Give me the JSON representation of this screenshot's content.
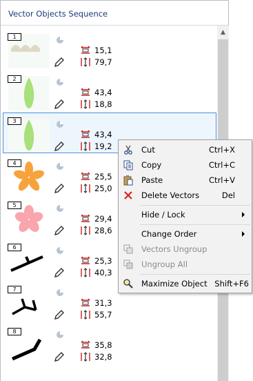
{
  "panel": {
    "title": "Vector Objects Sequence"
  },
  "items": [
    {
      "number": "1",
      "width": "15,1",
      "height": "79,7",
      "shape": "clouds",
      "color": "#ddd9c4"
    },
    {
      "number": "2",
      "width": "43,4",
      "height": "18,8",
      "shape": "leaf",
      "color": "#a8e07c"
    },
    {
      "number": "3",
      "width": "43,4",
      "height": "19,2",
      "shape": "leaf",
      "color": "#a8e07c",
      "selected": true
    },
    {
      "number": "4",
      "width": "25,5",
      "height": "25,0",
      "shape": "flower",
      "color": "#f7a33c"
    },
    {
      "number": "5",
      "width": "29,4",
      "height": "28,6",
      "shape": "flower",
      "color": "#f8a5ae"
    },
    {
      "number": "6",
      "width": "25,3",
      "height": "40,3",
      "shape": "line-a",
      "color": "#000000"
    },
    {
      "number": "7",
      "width": "31,3",
      "height": "55,7",
      "shape": "line-b",
      "color": "#000000"
    },
    {
      "number": "8",
      "width": "35,8",
      "height": "32,8",
      "shape": "line-c",
      "color": "#000000"
    }
  ],
  "menu": {
    "cut": {
      "label": "Cut",
      "shortcut": "Ctrl+X",
      "icon": "scissors-icon"
    },
    "copy": {
      "label": "Copy",
      "shortcut": "Ctrl+C",
      "icon": "copy-icon"
    },
    "paste": {
      "label": "Paste",
      "shortcut": "Ctrl+V",
      "icon": "paste-icon"
    },
    "delete": {
      "label": "Delete Vectors",
      "shortcut": "Del",
      "icon": "red-x-icon"
    },
    "hide_lock": {
      "label": "Hide / Lock"
    },
    "change_order": {
      "label": "Change Order"
    },
    "ungroup": {
      "label": "Vectors Ungroup",
      "icon": "ungroup-icon"
    },
    "ungroup_all": {
      "label": "Ungroup All",
      "icon": "ungroup-all-icon"
    },
    "maximize": {
      "label": "Maximize Object",
      "shortcut": "Shift+F6",
      "icon": "magnifier-icon"
    }
  },
  "colors": {
    "accent": "#4a90d9",
    "title": "#1e3a78",
    "delete": "#e02020"
  }
}
